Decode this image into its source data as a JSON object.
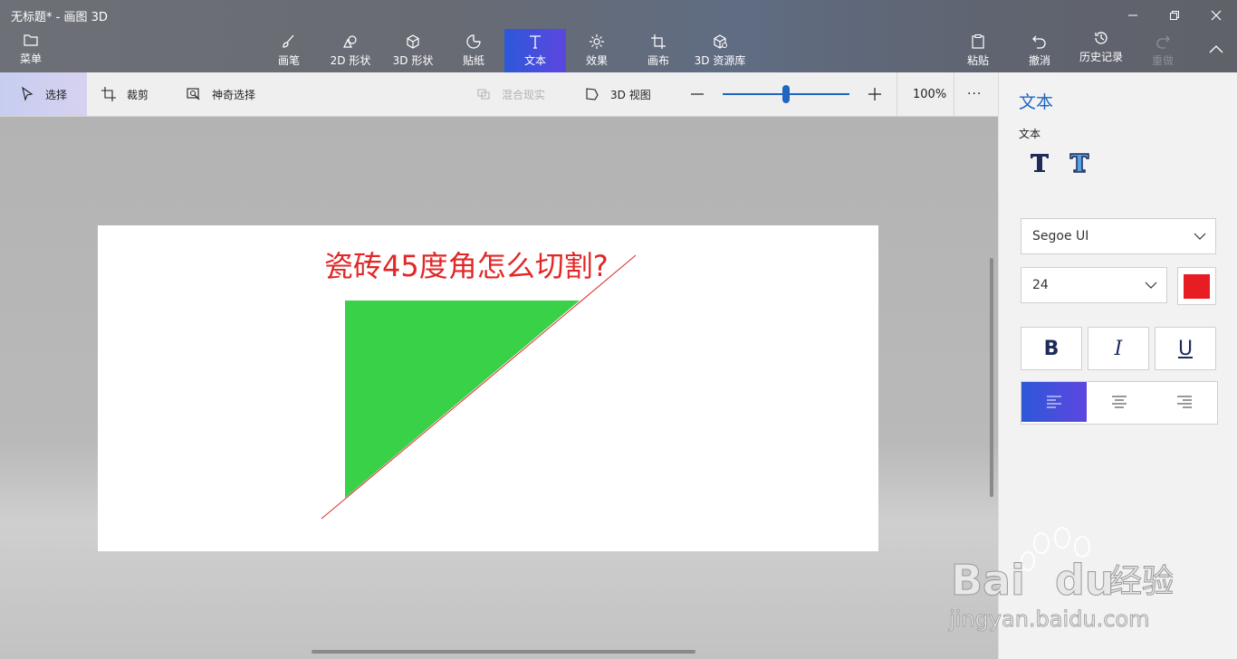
{
  "window": {
    "title": "无标题* - 画图 3D",
    "controls": [
      "minimize-icon",
      "restore-icon",
      "close-icon"
    ]
  },
  "toolbar": {
    "menu_label": "菜单",
    "tools": [
      {
        "label": "画笔",
        "icon": "brush-icon"
      },
      {
        "label": "2D 形状",
        "icon": "2d-shapes-icon"
      },
      {
        "label": "3D 形状",
        "icon": "3d-shapes-icon"
      },
      {
        "label": "贴纸",
        "icon": "stickers-icon"
      },
      {
        "label": "文本",
        "icon": "text-icon",
        "active": true
      },
      {
        "label": "效果",
        "icon": "effects-icon"
      },
      {
        "label": "画布",
        "icon": "canvas-icon"
      },
      {
        "label": "3D 资源库",
        "icon": "3d-library-icon"
      }
    ],
    "right": [
      {
        "label": "粘贴",
        "icon": "paste-icon"
      },
      {
        "label": "撤消",
        "icon": "undo-icon"
      },
      {
        "label": "历史记录",
        "icon": "history-icon"
      },
      {
        "label": "重做",
        "icon": "redo-icon",
        "disabled": true
      }
    ],
    "accent_gradient": [
      "#2d58d8",
      "#5d46e0"
    ]
  },
  "subbar": {
    "select_label": "选择",
    "crop_label": "裁剪",
    "magic_select_label": "神奇选择",
    "mixed_reality_label": "混合现实",
    "view3d_label": "3D 视图",
    "zoom": "100%",
    "zoom_slider_fraction": 0.5,
    "more_label": "···"
  },
  "canvas": {
    "title_text": "瓷砖45度角怎么切割?",
    "title_color": "#e12727",
    "triangle_color": "#39d147",
    "line_color": "#d62a2a"
  },
  "panel": {
    "title": "文本",
    "subtitle": "文本",
    "font_family": "Segoe UI",
    "font_size": "24",
    "text_color": "#e81c23",
    "bold_label": "B",
    "italic_label": "I",
    "underline_label": "U",
    "active_align": "left"
  },
  "watermark": {
    "text_brand": "Bai",
    "text_brand2": "du",
    "text_cn": "经验",
    "url": "jingyan.baidu.com"
  }
}
